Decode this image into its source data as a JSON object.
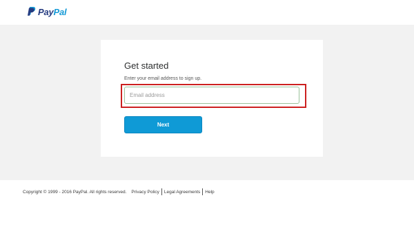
{
  "brand": {
    "logo_pay": "Pay",
    "logo_pal": "Pal",
    "primary_color": "#253b80",
    "accent_color": "#179bd7"
  },
  "signup": {
    "title": "Get started",
    "subtitle": "Enter your email address to sign up.",
    "email_placeholder": "Email address",
    "email_value": "",
    "next_label": "Next",
    "highlight_color": "#cc1f1f",
    "button_color": "#0f9ad6"
  },
  "footer": {
    "copyright": "Copyright © 1999 - 2016 PayPal. All rights reserved.",
    "links": [
      "Privacy Policy",
      "Legal Agreements",
      "Help"
    ]
  }
}
